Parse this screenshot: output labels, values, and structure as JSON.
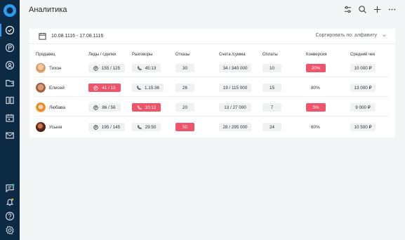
{
  "app": {
    "page_title": "Аналитика",
    "accent": "#2e9bf0",
    "sidebar_bg": "#0d2a45",
    "alert_color": "#f0546b"
  },
  "filters": {
    "date_range": "10.08.1116 - 17.08.1116",
    "sort_label": "Сортировать по: алфавиту"
  },
  "columns": [
    "Продавец",
    "Лиды / сделки",
    "Разговоры",
    "Отказы",
    "Счета /сумма",
    "Оплаты",
    "Конверсия",
    "Средний чек"
  ],
  "rows": [
    {
      "seller": "Тихон",
      "leads": "155 / 125",
      "leads_alert": false,
      "calls": "45:13",
      "calls_alert": false,
      "refusals": "30",
      "refusals_alert": false,
      "invoices": "34 / 340 000",
      "payments": "10",
      "conversion": "20%",
      "conversion_alert": true,
      "avg_check": "10 000 ₽"
    },
    {
      "seller": "Елисей",
      "leads": "41 / 15",
      "leads_alert": true,
      "calls": "1.15:36",
      "calls_alert": false,
      "refusals": "26",
      "refusals_alert": false,
      "invoices": "19 / 115 000",
      "payments": "15",
      "conversion": "80%",
      "conversion_alert": false,
      "avg_check": "13 000 ₽"
    },
    {
      "seller": "Любава",
      "leads": "86 / 56",
      "leads_alert": false,
      "calls": "10:12",
      "calls_alert": true,
      "refusals": "20",
      "refusals_alert": false,
      "invoices": "13 / 27 000",
      "payments": "7",
      "conversion": "5%",
      "conversion_alert": true,
      "avg_check": "9 000 ₽"
    },
    {
      "seller": "Усыня",
      "leads": "195 / 145",
      "leads_alert": false,
      "calls": "29:50",
      "calls_alert": false,
      "refusals": "50",
      "refusals_alert": true,
      "invoices": "28 / 295 000",
      "payments": "24",
      "conversion": "60%",
      "conversion_alert": false,
      "avg_check": "10 500 ₽"
    }
  ],
  "icons": {
    "sidebar": [
      "logo",
      "check-circle-icon",
      "currency-icon",
      "user-circle-icon",
      "folder-icon",
      "kanban-icon",
      "calendar-icon",
      "mail-icon",
      "chat-icon",
      "bell-icon",
      "help-icon",
      "settings-icon"
    ],
    "top": [
      "filter-icon",
      "search-icon",
      "plus-icon",
      "more-icon"
    ]
  }
}
